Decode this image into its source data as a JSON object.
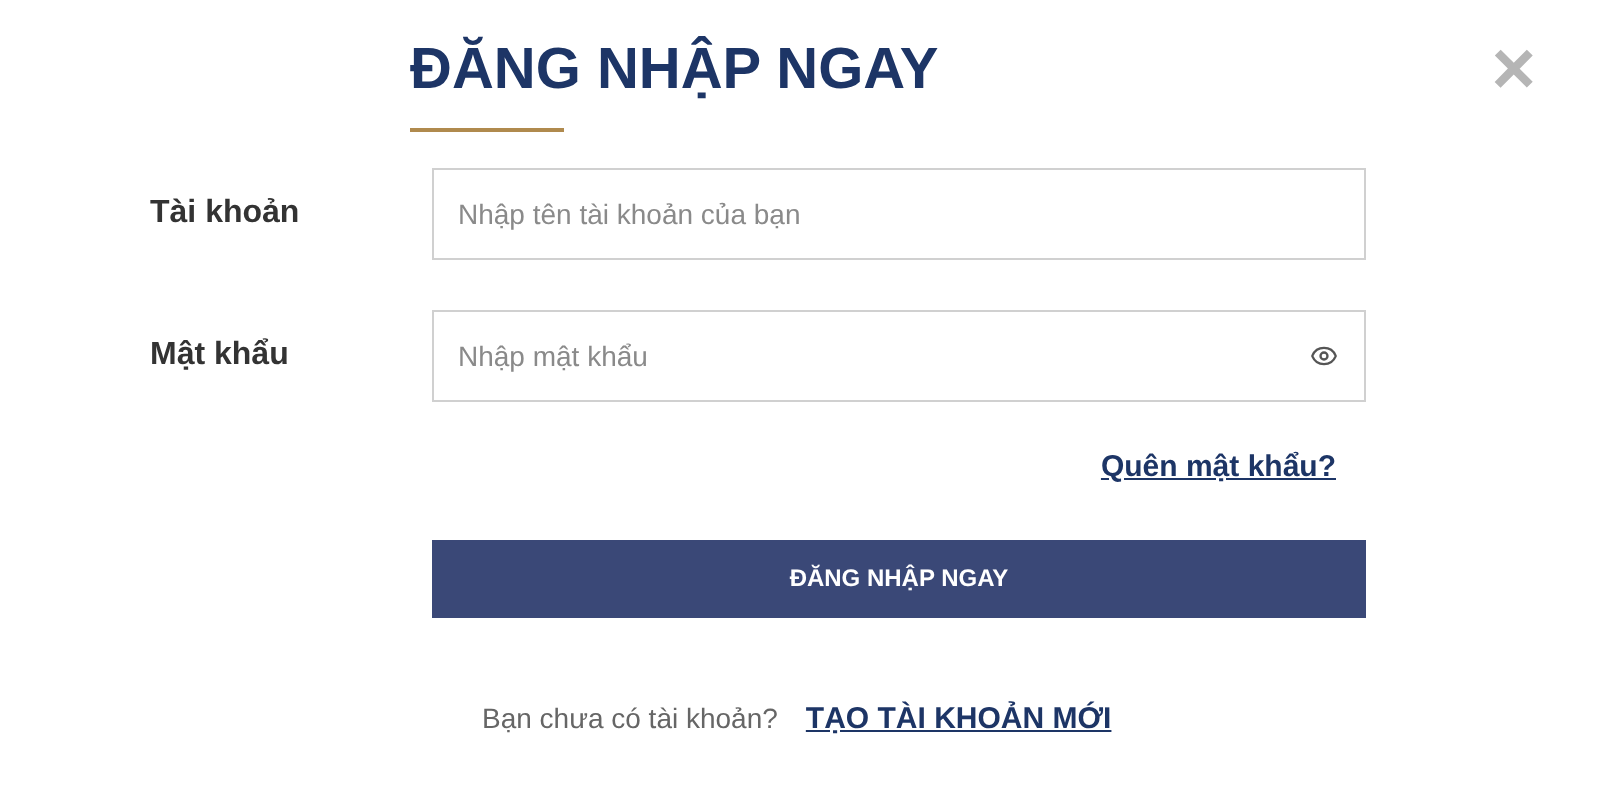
{
  "title": "ĐĂNG NHẬP NGAY",
  "close": "×",
  "fields": [
    {
      "label": "Tài khoản",
      "placeholder": "Nhập tên tài khoản của bạn",
      "kind": "text"
    },
    {
      "label": "Mật khẩu",
      "placeholder": "Nhập mật khẩu",
      "kind": "password"
    }
  ],
  "forgot_link": "Quên mật khẩu?",
  "submit_button": "ĐĂNG NHẬP NGAY",
  "signup": {
    "prompt": "Bạn chưa có tài khoản?",
    "link": "TẠO TÀI KHOẢN MỚI"
  }
}
